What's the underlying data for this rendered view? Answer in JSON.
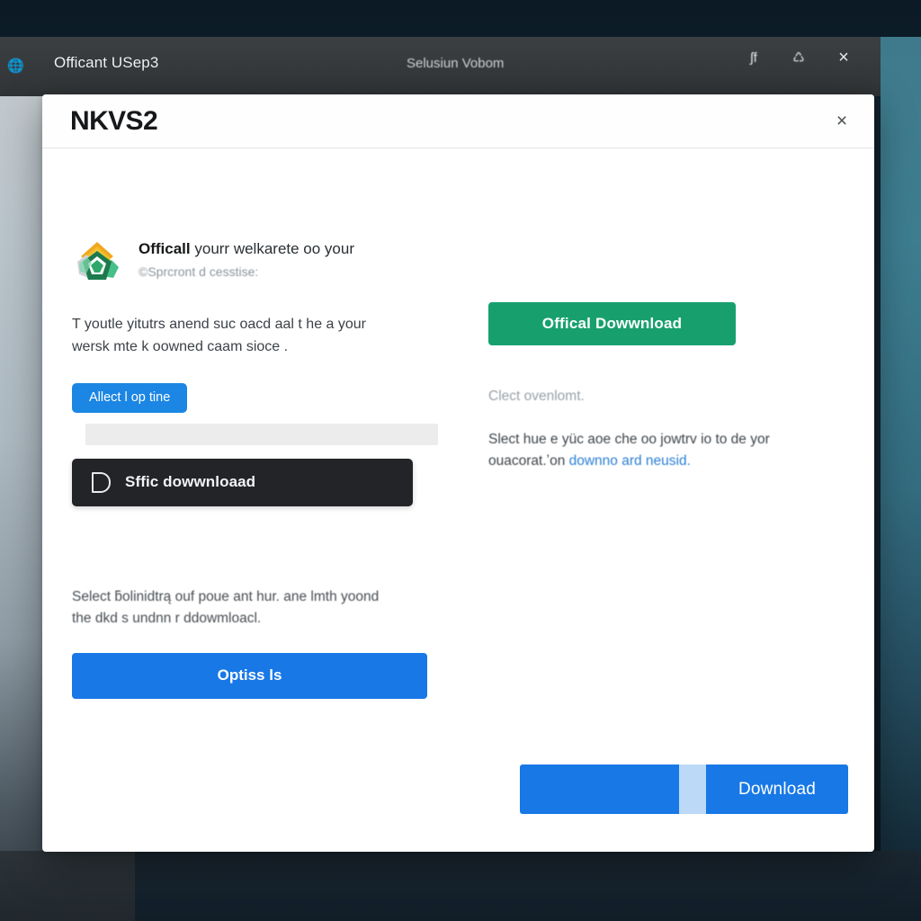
{
  "window": {
    "favicon_icon": "globe-icon",
    "title": "Officant USep3",
    "subtitle": "Selusiun Vobom",
    "actions": [
      {
        "name": "font-icon",
        "glyph": "ʃf"
      },
      {
        "name": "settings-icon",
        "glyph": "♺"
      },
      {
        "name": "close-icon",
        "glyph": "×"
      }
    ]
  },
  "dialog": {
    "title": "NKVS2",
    "close_icon": "×",
    "left": {
      "logo_icon": "app-logo-icon",
      "headline_strong": "Officall",
      "headline_rest": "yourr welkarete oo your",
      "subheadline": "©Sprcront d cesstise:",
      "paragraph": "T youtle yitutrs anend suc oacd aal t he a your wersk mte k oowned caam sioce .",
      "pill_button": "Allect l op tine",
      "grey_field_value": "",
      "dark_bar_icon": "disc-icon",
      "dark_bar_label": "Sffic dowwnloaad",
      "paragraph_2": "Select ƃolinidtrą ouf poue ant hur. ane lmth yoond the dkd s undnn r ddowmloacl.",
      "wide_button": "Optiss ls"
    },
    "right": {
      "green_button": "Offical  Dowwnload",
      "caption": "Clect ovenlomt.",
      "paragraph_lead": "Slect hue e yüc aoe che oo jowtrv io to de yor ouacorat.ʼon",
      "paragraph_link": "downno ard neusid."
    },
    "footer": {
      "progress_percent": 48,
      "download_label": "Download"
    }
  },
  "colors": {
    "accent_blue": "#1878e6",
    "accent_green": "#17a06e",
    "dark_bar": "#232427",
    "link_blue": "#2b7fd4",
    "titlebar": "#36393b"
  }
}
